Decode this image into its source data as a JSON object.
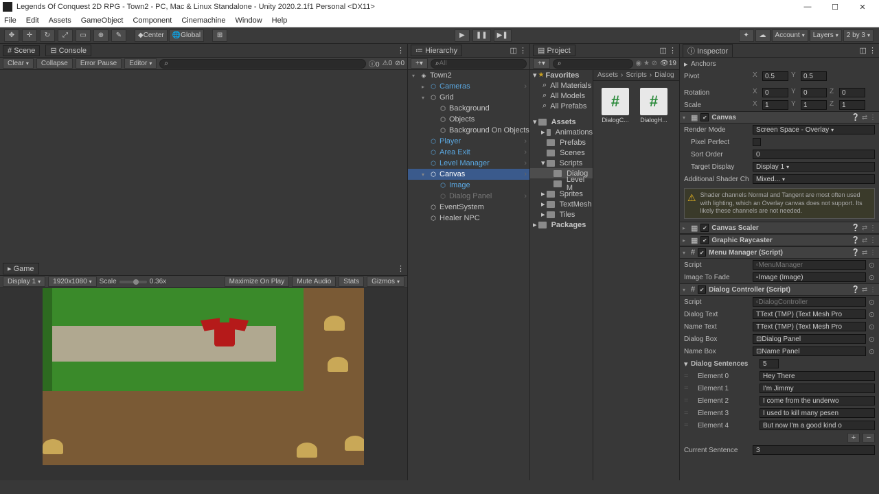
{
  "titlebar": "Legends Of Conquest 2D RPG - Town2 - PC, Mac & Linux Standalone - Unity 2020.2.1f1 Personal <DX11>",
  "menu": [
    "File",
    "Edit",
    "Assets",
    "GameObject",
    "Component",
    "Cinemachine",
    "Window",
    "Help"
  ],
  "toolbar": {
    "pivot": "Center",
    "space": "Global",
    "account": "Account",
    "layers": "Layers",
    "layout": "2 by 3"
  },
  "scene_tab": "Scene",
  "console_tab": "Console",
  "console": {
    "clear": "Clear",
    "collapse": "Collapse",
    "errorpause": "Error Pause",
    "editor": "Editor",
    "count0": "0",
    "count1": "0",
    "count2": "0"
  },
  "game_tab": "Game",
  "game": {
    "display": "Display 1",
    "res": "1920x1080",
    "scale_lbl": "Scale",
    "scale_val": "0.36x",
    "maxplay": "Maximize On Play",
    "mute": "Mute Audio",
    "stats": "Stats",
    "gizmos": "Gizmos"
  },
  "hierarchy_tab": "Hierarchy",
  "hierarchy_search": "All",
  "hierarchy": [
    {
      "d": 0,
      "t": "Town2",
      "blue": false,
      "exp": true,
      "scene": true
    },
    {
      "d": 1,
      "t": "Cameras",
      "blue": true,
      "exp": false,
      "more": true
    },
    {
      "d": 1,
      "t": "Grid",
      "blue": false,
      "exp": true
    },
    {
      "d": 2,
      "t": "Background",
      "blue": false
    },
    {
      "d": 2,
      "t": "Objects",
      "blue": false
    },
    {
      "d": 2,
      "t": "Background On Objects",
      "blue": false
    },
    {
      "d": 1,
      "t": "Player",
      "blue": true,
      "more": true
    },
    {
      "d": 1,
      "t": "Area Exit",
      "blue": true,
      "more": true
    },
    {
      "d": 1,
      "t": "Level Manager",
      "blue": true,
      "more": true
    },
    {
      "d": 1,
      "t": "Canvas",
      "blue": false,
      "exp": true,
      "sel": true,
      "more": true
    },
    {
      "d": 2,
      "t": "Image",
      "blue": true
    },
    {
      "d": 2,
      "t": "Dialog Panel",
      "gray": true,
      "more": true
    },
    {
      "d": 1,
      "t": "EventSystem",
      "blue": false
    },
    {
      "d": 1,
      "t": "Healer NPC",
      "blue": false
    }
  ],
  "project_tab": "Project",
  "project_count": "19",
  "project_tree": {
    "favorites": "Favorites",
    "allmat": "All Materials",
    "allmod": "All Models",
    "allpre": "All Prefabs",
    "assets": "Assets",
    "anim": "Animations",
    "prefabs": "Prefabs",
    "scenes": "Scenes",
    "scripts": "Scripts",
    "dialog": "Dialog",
    "levelm": "Level M",
    "sprites": "Sprites",
    "textmesh": "TextMesh",
    "tiles": "Tiles",
    "packages": "Packages"
  },
  "breadcrumb": [
    "Assets",
    "Scripts",
    "Dialog"
  ],
  "thumbs": [
    "DialogC...",
    "DialogH..."
  ],
  "inspector_tab": "Inspector",
  "insp": {
    "anchors": "Anchors",
    "pivot": "Pivot",
    "px": "0.5",
    "py": "0.5",
    "rotation": "Rotation",
    "rx": "0",
    "ry": "0",
    "rz": "0",
    "scale": "Scale",
    "sx": "1",
    "sy": "1",
    "sz": "1",
    "canvas": "Canvas",
    "rendermode_l": "Render Mode",
    "rendermode_v": "Screen Space - Overlay",
    "pixelperfect": "Pixel Perfect",
    "sortorder_l": "Sort Order",
    "sortorder_v": "0",
    "targetdisp_l": "Target Display",
    "targetdisp_v": "Display 1",
    "addshader_l": "Additional Shader Ch",
    "addshader_v": "Mixed...",
    "warn": "Shader channels Normal and Tangent are most often used with lighting, which an Overlay canvas does not support. Its likely these channels are not needed.",
    "canvasscaler": "Canvas Scaler",
    "raycaster": "Graphic Raycaster",
    "menumgr": "Menu Manager (Script)",
    "script_l": "Script",
    "menumgr_v": "MenuManager",
    "imgfade_l": "Image To Fade",
    "imgfade_v": "Image (Image)",
    "dialogctrl": "Dialog Controller (Script)",
    "dialogctrl_v": "DialogController",
    "dialogtext_l": "Dialog Text",
    "dialogtext_v": "Text (TMP) (Text Mesh Pro",
    "nametext_l": "Name Text",
    "nametext_v": "Text (TMP) (Text Mesh Pro",
    "dialogbox_l": "Dialog Box",
    "dialogbox_v": "Dialog Panel",
    "namebox_l": "Name Box",
    "namebox_v": "Name Panel",
    "dialogsent": "Dialog Sentences",
    "dialogsent_v": "5",
    "elems": [
      {
        "l": "Element 0",
        "v": "Hey There"
      },
      {
        "l": "Element 1",
        "v": "I'm Jimmy"
      },
      {
        "l": "Element 2",
        "v": "I come from the underwo"
      },
      {
        "l": "Element 3",
        "v": "I used to kill many pesen"
      },
      {
        "l": "Element 4",
        "v": "But now I'm a good kind o"
      }
    ],
    "cursent_l": "Current Sentence",
    "cursent_v": "3"
  }
}
